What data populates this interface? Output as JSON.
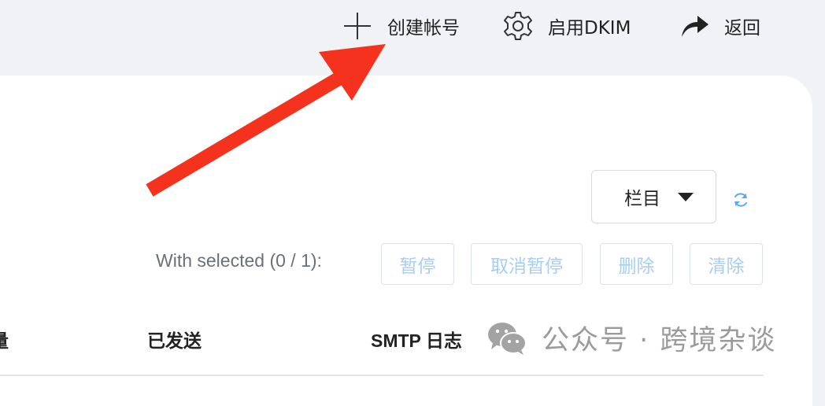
{
  "toolbar": {
    "create_account_label": "创建帐号",
    "enable_dkim_label": "启用DKIM",
    "back_label": "返回"
  },
  "filters": {
    "columns_label": "栏目"
  },
  "bulk": {
    "selected_label": "With selected (0 / 1):",
    "pause_label": "暂停",
    "unpause_label": "取消暂停",
    "delete_label": "删除",
    "clear_label": "清除"
  },
  "table": {
    "headers": [
      "量",
      "已发送",
      "SMTP 日志"
    ]
  },
  "watermark": {
    "text": "公众号 · 跨境杂谈"
  },
  "colors": {
    "background": "#f1f2f5",
    "panel": "#ffffff",
    "disabled_text": "#a8cdf2",
    "refresh": "#5aa9ef",
    "annotation_arrow": "#f5321e"
  },
  "icons": [
    "plus-icon",
    "gear-icon",
    "share-arrow-icon",
    "caret-down-icon",
    "refresh-icon",
    "wechat-icon"
  ]
}
